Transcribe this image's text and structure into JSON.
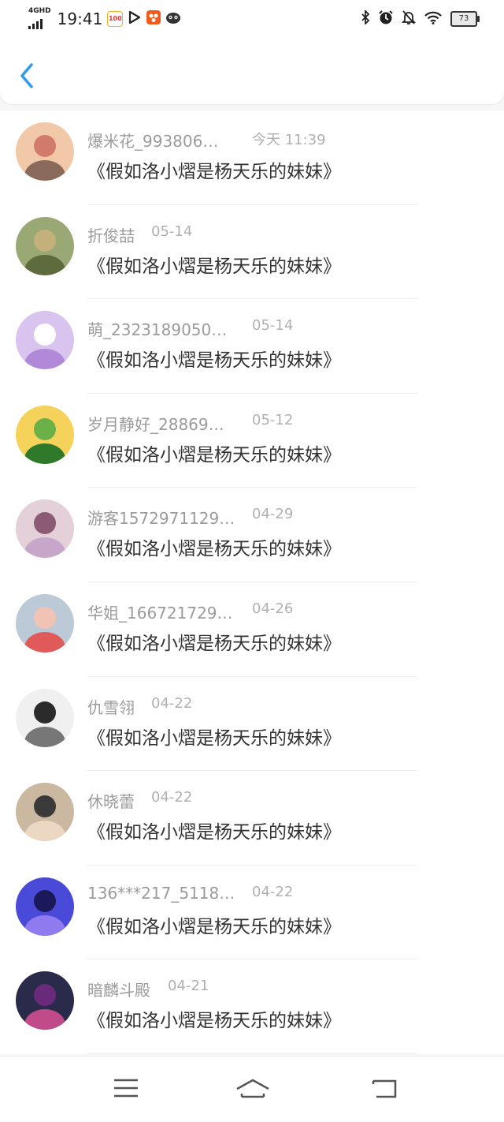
{
  "status_bar": {
    "network": "4GHD",
    "time": "19:41",
    "battery": "73",
    "icons": [
      "app-100-icon",
      "video-play-icon",
      "app-orange-icon",
      "app-face-icon",
      "bluetooth-icon",
      "alarm-icon",
      "bell-off-icon",
      "wifi-icon"
    ],
    "app_100_label": "100"
  },
  "header": {
    "back_icon": "chevron-left-icon",
    "accent": "#2e9bf0"
  },
  "comments": [
    {
      "name": "爆米花_993806…",
      "date": "今天 11:39",
      "text": "《假如洛小熠是杨天乐的妹妹》"
    },
    {
      "name": "折俊喆",
      "date": "05-14",
      "text": "《假如洛小熠是杨天乐的妹妹》"
    },
    {
      "name": "萌_2323189050…",
      "date": "05-14",
      "text": "《假如洛小熠是杨天乐的妹妹》"
    },
    {
      "name": "岁月静好_28869…",
      "date": "05-12",
      "text": "《假如洛小熠是杨天乐的妹妹》"
    },
    {
      "name": "游客1572971129…",
      "date": "04-29",
      "text": "《假如洛小熠是杨天乐的妹妹》"
    },
    {
      "name": "华姐_166721729…",
      "date": "04-26",
      "text": "《假如洛小熠是杨天乐的妹妹》"
    },
    {
      "name": "仇雪翎",
      "date": "04-22",
      "text": "《假如洛小熠是杨天乐的妹妹》"
    },
    {
      "name": "休晓蕾",
      "date": "04-22",
      "text": "《假如洛小熠是杨天乐的妹妹》"
    },
    {
      "name": "136***217_5118…",
      "date": "04-22",
      "text": "《假如洛小熠是杨天乐的妹妹》"
    },
    {
      "name": "暗麟斗殿",
      "date": "04-21",
      "text": "《假如洛小熠是杨天乐的妹妹》"
    }
  ],
  "nav_bar": {
    "icons": [
      "menu-icon",
      "home-icon",
      "back-icon"
    ]
  }
}
